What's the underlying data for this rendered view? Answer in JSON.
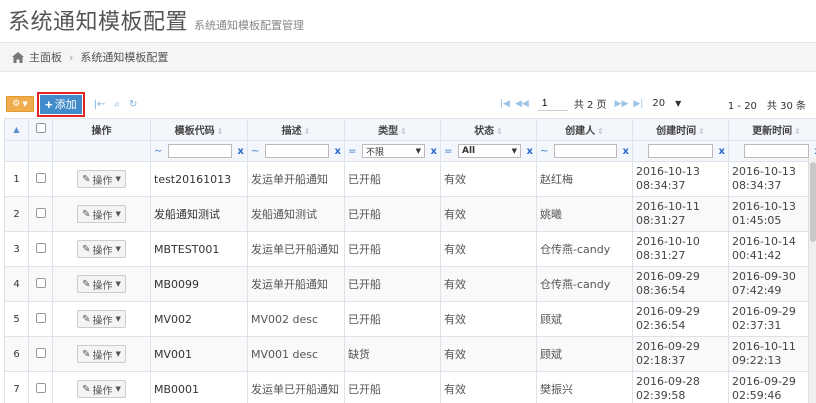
{
  "header": {
    "title": "系统通知模板配置",
    "subtitle": "系统通知模板配置管理"
  },
  "breadcrumb": {
    "home": "主面板",
    "current": "系统通知模板配置"
  },
  "toolbar": {
    "add_label": "添加",
    "page_input": "1",
    "total_pages": "共 2 页",
    "page_size": "20",
    "records": "1 - 20　共 30 条"
  },
  "columns": {
    "op": "操作",
    "code": "模板代码",
    "desc": "描述",
    "type": "类型",
    "status": "状态",
    "creator": "创建人",
    "created": "创建时间",
    "updated": "更新时间"
  },
  "filters": {
    "type_value": "不限",
    "status_value": "All",
    "clear": "x",
    "like_op": "~",
    "eq_op": "="
  },
  "row_action_label": "操作",
  "rows": [
    {
      "n": "1",
      "code": "test20161013",
      "desc": "发运单开船通知",
      "type": "已开船",
      "status": "有效",
      "creator": "赵红梅",
      "created_d": "2016-10-13",
      "created_t": "08:34:37",
      "updated_d": "2016-10-13",
      "updated_t": "08:34:37"
    },
    {
      "n": "2",
      "code": "发船通知测试",
      "desc": "发船通知测试",
      "type": "已开船",
      "status": "有效",
      "creator": "姚曦",
      "created_d": "2016-10-11",
      "created_t": "08:31:27",
      "updated_d": "2016-10-13",
      "updated_t": "01:45:05"
    },
    {
      "n": "3",
      "code": "MBTEST001",
      "desc": "发运单已开船通知",
      "type": "已开船",
      "status": "有效",
      "creator": "仓传燕-candy",
      "created_d": "2016-10-10",
      "created_t": "08:31:27",
      "updated_d": "2016-10-14",
      "updated_t": "00:41:42"
    },
    {
      "n": "4",
      "code": "MB0099",
      "desc": "发运单开船通知",
      "type": "已开船",
      "status": "有效",
      "creator": "仓传燕-candy",
      "created_d": "2016-09-29",
      "created_t": "08:36:54",
      "updated_d": "2016-09-30",
      "updated_t": "07:42:49"
    },
    {
      "n": "5",
      "code": "MV002",
      "desc": "MV002 desc",
      "type": "已开船",
      "status": "有效",
      "creator": "顾斌",
      "created_d": "2016-09-29",
      "created_t": "02:36:54",
      "updated_d": "2016-09-29",
      "updated_t": "02:37:31"
    },
    {
      "n": "6",
      "code": "MV001",
      "desc": "MV001 desc",
      "type": "缺货",
      "status": "有效",
      "creator": "顾斌",
      "created_d": "2016-09-29",
      "created_t": "02:18:37",
      "updated_d": "2016-10-11",
      "updated_t": "09:22:13"
    },
    {
      "n": "7",
      "code": "MB0001",
      "desc": "发运单已开船通知",
      "type": "已开船",
      "status": "有效",
      "creator": "樊振兴",
      "created_d": "2016-09-28",
      "created_t": "02:39:58",
      "updated_d": "2016-09-29",
      "updated_t": "02:59:46"
    }
  ],
  "colors": {
    "accent": "#428bca",
    "highlight": "#e02424",
    "warning": "#f0ad4e"
  }
}
